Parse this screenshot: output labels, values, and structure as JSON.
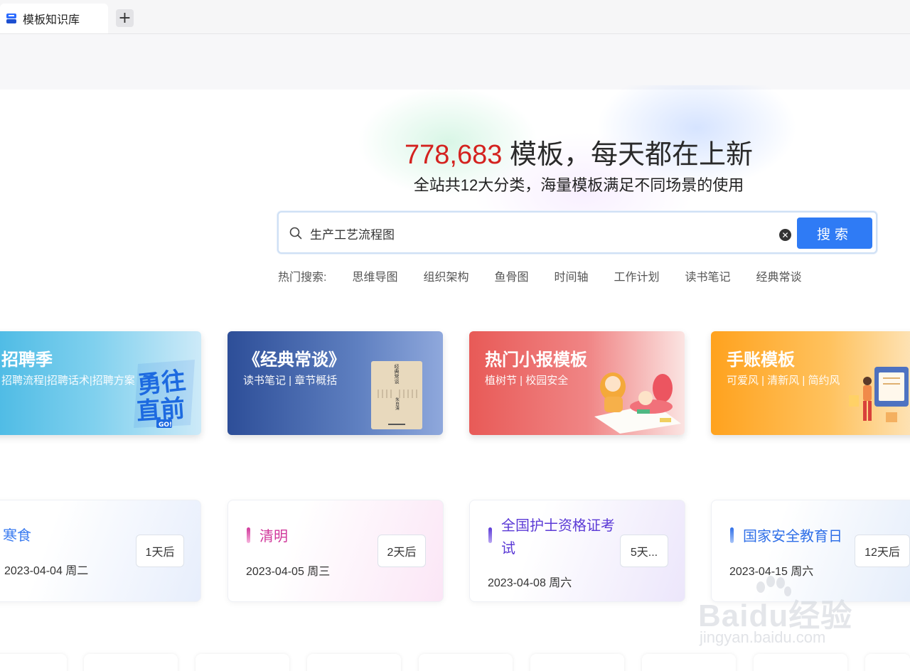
{
  "tab": {
    "title": "模板知识库",
    "new_tab": "+"
  },
  "hero": {
    "count": "778,683",
    "headline_rest": " 模板，每天都在上新",
    "subtitle": "全站共12大分类，海量模板满足不同场景的使用"
  },
  "search": {
    "value": "生产工艺流程图",
    "button": "搜索"
  },
  "hot": {
    "label": "热门搜索:",
    "items": [
      "思维导图",
      "组织架构",
      "鱼骨图",
      "时间轴",
      "工作计划",
      "读书笔记",
      "经典常谈"
    ]
  },
  "banners": [
    {
      "title": "招聘季",
      "subtitle": "招聘流程|招聘话术|招聘方案",
      "art_text": "勇往直前",
      "art_badge": "GO!"
    },
    {
      "title": "《经典常谈》",
      "subtitle": "读书笔记 | 章节概括",
      "book_title": "经典常谈",
      "book_author": "朱自清"
    },
    {
      "title": "热门小报模板",
      "subtitle": "植树节 | 校园安全"
    },
    {
      "title": "手账模板",
      "subtitle": "可爱风 | 清新风 | 简约风"
    }
  ],
  "calendar": [
    {
      "title": "寒食",
      "date": "2023-04-04 周二",
      "countdown": "1天后",
      "color": "#3a7bf0"
    },
    {
      "title": "清明",
      "date": "2023-04-05 周三",
      "countdown": "2天后",
      "color": "#d0389b"
    },
    {
      "title": "全国护士资格证考试",
      "date": "2023-04-08 周六",
      "countdown": "5天...",
      "color": "#5b3ad6"
    },
    {
      "title": "国家安全教育日",
      "date": "2023-04-15 周六",
      "countdown": "12天后",
      "color": "#2f6fe8"
    }
  ],
  "watermark": {
    "brand": "Baidu经验",
    "url": "jingyan.baidu.com"
  }
}
